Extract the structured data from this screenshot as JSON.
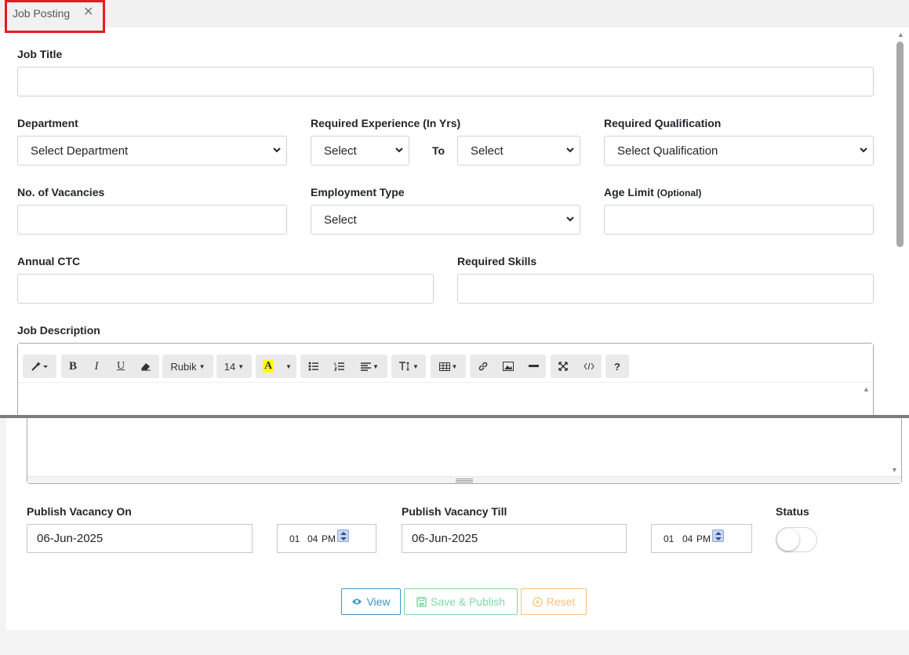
{
  "tab": {
    "label": "Job Posting",
    "close_glyph": "✕"
  },
  "form": {
    "job_title": {
      "label": "Job Title",
      "value": ""
    },
    "department": {
      "label": "Department",
      "selected": "Select Department"
    },
    "experience": {
      "label": "Required Experience (In Yrs)",
      "from_selected": "Select",
      "to_label": "To",
      "to_selected": "Select"
    },
    "qualification": {
      "label": "Required Qualification",
      "selected": "Select Qualification"
    },
    "vacancies": {
      "label": "No. of Vacancies",
      "value": ""
    },
    "employment_type": {
      "label": "Employment Type",
      "selected": "Select"
    },
    "age_limit": {
      "label": "Age Limit",
      "optional": "(Optional)",
      "value": ""
    },
    "annual_ctc": {
      "label": "Annual CTC",
      "value": ""
    },
    "required_skills": {
      "label": "Required Skills",
      "value": ""
    },
    "job_description": {
      "label": "Job Description"
    }
  },
  "editor_toolbar": {
    "font_name": "Rubik",
    "font_size": "14",
    "highlight_glyph": "A",
    "bold": "B",
    "italic": "I",
    "underline": "U",
    "help": "?"
  },
  "publish": {
    "on_label": "Publish Vacancy On",
    "on_date": "06-Jun-2025",
    "on_time_hour": "01",
    "on_time_min": "04",
    "on_time_ampm": "PM",
    "till_label": "Publish Vacancy Till",
    "till_date": "06-Jun-2025",
    "till_time_hour": "01",
    "till_time_min": "04",
    "till_time_ampm": "PM",
    "status_label": "Status",
    "status_on": false
  },
  "buttons": {
    "view": "View",
    "save_publish": "Save & Publish",
    "reset": "Reset"
  },
  "colors": {
    "tab_highlight": "#e31b23",
    "view": "#3a97c9",
    "save": "#7fd9a5",
    "reset": "#f7c27a"
  }
}
